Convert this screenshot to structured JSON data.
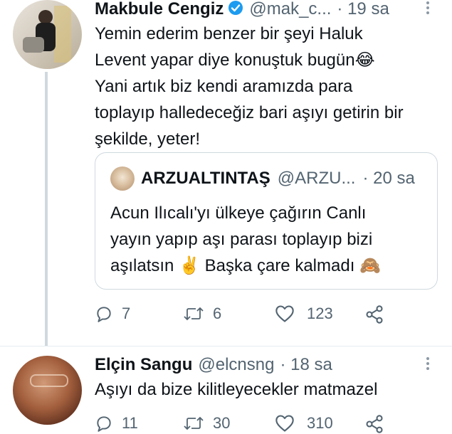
{
  "tweet1": {
    "name": "Makbule Cengiz",
    "handle": "@mak_c...",
    "time": "· 19 sa",
    "lines": [
      "Yemin ederim benzer bir şeyi Haluk",
      "Levent yapar diye konuştuk bugün😂",
      "Yani artık biz kendi aramızda para",
      "toplayıp halledeceğiz bari aşıyı getirin bir",
      "şekilde, yeter!"
    ],
    "actions": {
      "reply": "7",
      "retweet": "6",
      "like": "123"
    },
    "icons": {
      "verified": "verified-badge-icon",
      "more": "more-icon"
    }
  },
  "quote": {
    "name": "ARZUALTINTAŞ",
    "handle": "@ARZU...",
    "time": "· 20 sa",
    "lines": [
      "Acun Ilıcalı'yı ülkeye çağırın Canlı",
      "yayın yapıp aşı parası toplayıp bizi",
      "aşılatsın ✌️ Başka çare kalmadı 🙈"
    ]
  },
  "tweet2": {
    "name": "Elçin Sangu",
    "handle": "@elcnsng",
    "time": "· 18 sa",
    "text": "Aşıyı da bize kilitleyecekler matmazel",
    "actions": {
      "reply": "11",
      "retweet": "30",
      "like": "310"
    }
  },
  "colors": {
    "accent": "#1d9bf0",
    "muted": "#536471",
    "border": "#cfd9de"
  }
}
